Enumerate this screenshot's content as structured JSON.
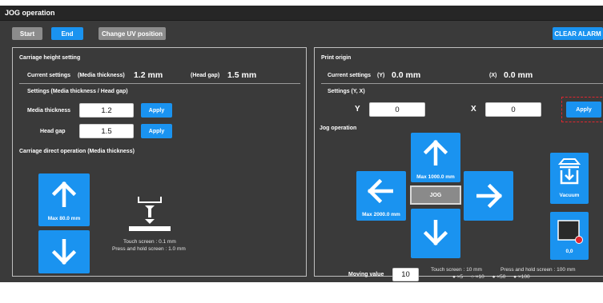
{
  "title": "JOG operation",
  "toolbar": {
    "start": "Start",
    "end": "End",
    "change_uv": "Change UV position",
    "clear_alarm": "CLEAR ALARM"
  },
  "carriage": {
    "heading": "Carriage height setting",
    "current_label": "Current settings",
    "media_label": "(Media thickness)",
    "media_value": "1.2 mm",
    "head_label": "(Head gap)",
    "head_value": "1.5 mm",
    "settings_heading": "Settings (Media thickness / Head gap)",
    "media_thickness_label": "Media thickness",
    "media_thickness_value": "1.2",
    "head_gap_label": "Head gap",
    "head_gap_value": "1.5",
    "apply": "Apply",
    "direct_heading": "Carriage direct operation (Media thickness)",
    "up_caption": "Max 80.0 mm",
    "touch_note": "Touch screen : 0.1 mm",
    "hold_note": "Press and hold screen : 1.0 mm"
  },
  "print_origin": {
    "heading": "Print origin",
    "current_label": "Current settings",
    "y_tag": "(Y)",
    "y_value": "0.0 mm",
    "x_tag": "(X)",
    "x_value": "0.0 mm",
    "settings_heading": "Settings (Y, X)",
    "y_label": "Y",
    "y_input": "0",
    "x_label": "X",
    "x_input": "0",
    "apply": "Apply"
  },
  "jog": {
    "heading": "Jog operation",
    "up_caption": "Max 1000.0 mm",
    "left_caption": "Max 2000.0 mm",
    "center": "JOG",
    "vacuum": "Vacuum",
    "origin_caption": "0,0",
    "moving_label": "Moving value",
    "moving_value": "10",
    "touch_note": "Touch screen : 10 mm",
    "hold_note": "Press and hold screen : 100 mm",
    "multipliers": [
      {
        "symbol": "●",
        "label": "×5"
      },
      {
        "symbol": "○",
        "label": "×10"
      },
      {
        "symbol": "●",
        "label": "×50"
      },
      {
        "symbol": "●",
        "label": "×100"
      }
    ]
  },
  "colors": {
    "accent": "#1a93f0",
    "panel": "#3a3a3a",
    "titlebar": "#262626",
    "highlight": "#e0262f"
  }
}
